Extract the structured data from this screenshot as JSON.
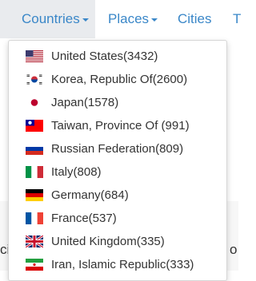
{
  "nav": {
    "countries": "Countries",
    "places": "Places",
    "cities": "Cities",
    "partial": "T"
  },
  "background": {
    "left_fragment": "ci",
    "right_fragment": "o"
  },
  "dropdown": {
    "items": [
      {
        "label": "United States(3432)",
        "flag": "us-flag-icon"
      },
      {
        "label": "Korea, Republic Of(2600)",
        "flag": "kr-flag-icon"
      },
      {
        "label": "Japan(1578)",
        "flag": "jp-flag-icon"
      },
      {
        "label": "Taiwan, Province Of (991)",
        "flag": "tw-flag-icon"
      },
      {
        "label": "Russian Federation(809)",
        "flag": "ru-flag-icon"
      },
      {
        "label": "Italy(808)",
        "flag": "it-flag-icon"
      },
      {
        "label": "Germany(684)",
        "flag": "de-flag-icon"
      },
      {
        "label": "France(537)",
        "flag": "fr-flag-icon"
      },
      {
        "label": "United Kingdom(335)",
        "flag": "gb-flag-icon"
      },
      {
        "label": "Iran, Islamic Republic(333)",
        "flag": "ir-flag-icon"
      }
    ]
  },
  "colors": {
    "link": "#3a87c8",
    "active_tab_bg": "#e9ebee",
    "text": "#333333"
  }
}
